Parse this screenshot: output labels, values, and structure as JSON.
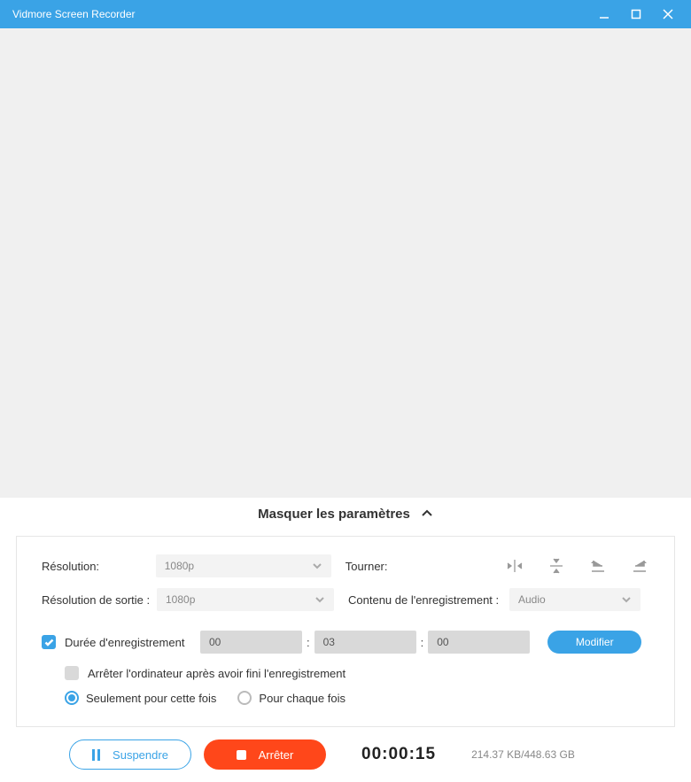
{
  "titlebar": {
    "title": "Vidmore Screen Recorder"
  },
  "params_toggle": {
    "label": "Masquer les paramètres"
  },
  "settings": {
    "resolution_label": "Résolution:",
    "resolution_value": "1080p",
    "output_resolution_label": "Résolution de sortie :",
    "output_resolution_value": "1080p",
    "rotate_label": "Tourner:",
    "content_label": "Contenu de l'enregistrement :",
    "content_value": "Audio"
  },
  "duration": {
    "enabled_label": "Durée d'enregistrement",
    "hours": "00",
    "minutes": "03",
    "seconds": "00",
    "modify_label": "Modifier",
    "shutdown_label": "Arrêter l'ordinateur après avoir fini l'enregistrement",
    "once_label": "Seulement pour cette fois",
    "each_label": "Pour chaque fois"
  },
  "footer": {
    "suspend_label": "Suspendre",
    "stop_label": "Arrêter",
    "timer": "00:00:15",
    "disk": "214.37 KB/448.63 GB"
  }
}
